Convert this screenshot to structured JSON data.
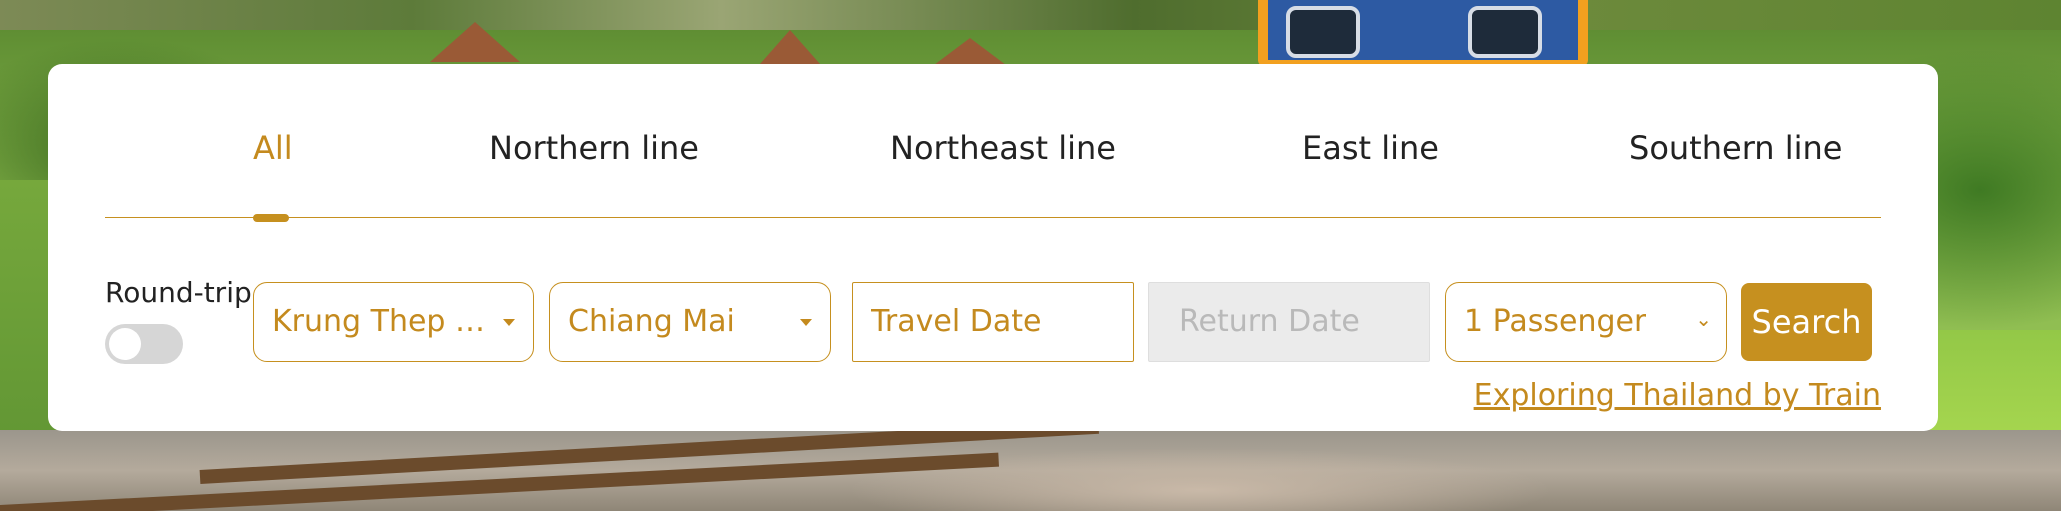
{
  "tabs": [
    {
      "label": "All",
      "active": true
    },
    {
      "label": "Northern line",
      "active": false
    },
    {
      "label": "Northeast line",
      "active": false
    },
    {
      "label": "East line",
      "active": false
    },
    {
      "label": "Southern line",
      "active": false
    }
  ],
  "round_trip": {
    "label": "Round-trip",
    "enabled": false
  },
  "form": {
    "origin": "Krung Thep Ap...",
    "destination": "Chiang Mai",
    "travel_date_placeholder": "Travel Date",
    "return_date_placeholder": "Return Date",
    "passengers": "1 Passenger",
    "search_label": "Search"
  },
  "explore_link": "Exploring Thailand by Train",
  "colors": {
    "accent": "#c6901f",
    "text": "#222222",
    "disabled_bg": "#ebebeb",
    "toggle_off": "#d6d6d6"
  }
}
